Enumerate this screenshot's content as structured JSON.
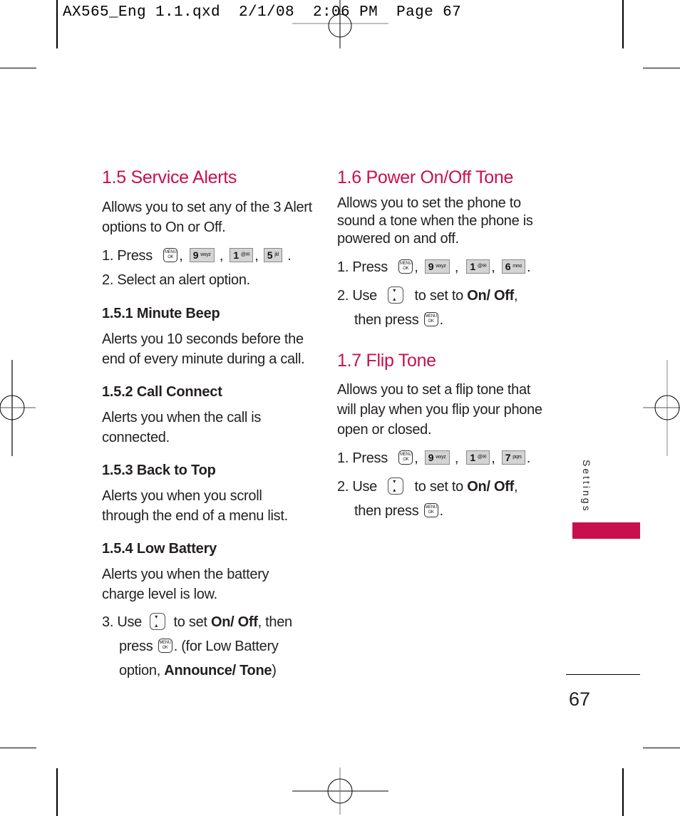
{
  "slug": "AX565_Eng 1.1.qxd  2/1/08  2:06 PM  Page 67",
  "colors": {
    "accent": "#c8104e",
    "text": "#231f20"
  },
  "icons": {
    "menu_ok": "menu-ok-key",
    "nav": "up-down-nav-key",
    "key_9": {
      "digit": "9",
      "letters": "wxyz"
    },
    "key_1": {
      "digit": "1",
      "letters": "@✉"
    },
    "key_5": {
      "digit": "5",
      "letters": "jkl"
    },
    "key_6": {
      "digit": "6",
      "letters": "mno"
    },
    "key_7": {
      "digit": "7",
      "letters": "pqrs"
    },
    "menu_top": "MENU",
    "menu_bottom": "OK"
  },
  "left": {
    "title": "1.5 Service Alerts",
    "intro": "Allows you to set any of the 3 Alert options to On or Off.",
    "step1_prefix": "1. Press",
    "step2": "2. Select an alert option.",
    "subsections": [
      {
        "title": "1.5.1 Minute Beep",
        "body": "Alerts you 10 seconds before the end of every minute during a call."
      },
      {
        "title": "1.5.2 Call Connect",
        "body": "Alerts you when the call is connected."
      },
      {
        "title": "1.5.3 Back to Top",
        "body": "Alerts you when you scroll through the end of a menu list."
      },
      {
        "title": "1.5.4 Low Battery",
        "body": "Alerts you when the battery charge level is low."
      }
    ],
    "step3": {
      "prefix": "3. Use",
      "mid": "to set",
      "on_off": "On/ Off",
      "then": ", then",
      "press": "press",
      "after": ". (for Low Battery",
      "option": "option,",
      "announce_tone": "Announce/ Tone",
      "close": ")"
    }
  },
  "right": {
    "power": {
      "title": "1.6 Power On/Off Tone",
      "intro": "Allows you to set the phone to sound a tone when the phone is powered on and off.",
      "step1_prefix": "1. Press",
      "step2_prefix": "2. Use",
      "step2_mid": "to set to",
      "on_off": "On/ Off",
      "then_press": "then press"
    },
    "flip": {
      "title": "1.7 Flip Tone",
      "intro": "Allows you to set a flip tone that will play when you flip your phone open or closed.",
      "step1_prefix": "1. Press",
      "step2_prefix": "2. Use",
      "step2_mid": "to set to",
      "on_off": "On/ Off",
      "then_press": "then press"
    }
  },
  "sidebar": {
    "label": "Settings"
  },
  "page_number": "67"
}
